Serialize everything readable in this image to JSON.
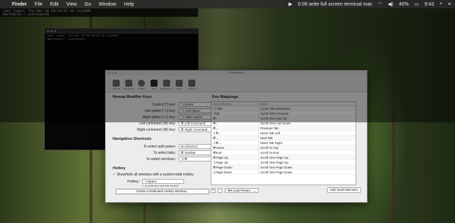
{
  "menubar": {
    "app": "Finder",
    "items": [
      "File",
      "Edit",
      "View",
      "Go",
      "Window",
      "Help"
    ],
    "status_text": "0:06 write full screen terminal mac",
    "battery": "40%",
    "time": "9:43"
  },
  "terminal_top": {
    "line1": "Last login: Thu Dec 28 03:10:07 on ttys000",
    "line2": "MacThGray:~ justinpot$"
  },
  "terminal_window": {
    "line1": "Last login: Thu Dec 28 09:38:13 on ttys001",
    "line2": "MacThGrey:~ justinpot$"
  },
  "prefs": {
    "title": "Preferences",
    "toolbar": [
      "General",
      "Appearance",
      "Profiles",
      "Keys",
      "Arrangements",
      "Pointer",
      "Advanced"
    ],
    "remap_heading": "Remap Modifier Keys",
    "remap_rows": [
      {
        "label": "Control (^) key:",
        "value": "^ Control"
      },
      {
        "label": "Left option (⌥) key:",
        "value": "⌥ Left Option"
      },
      {
        "label": "Right option (⌥) key:",
        "value": "⌥ Right Option"
      },
      {
        "label": "Left command (⌘) key:",
        "value": "⌘ Left Command"
      },
      {
        "label": "Right command (⌘) key:",
        "value": "⌘ Right Command"
      }
    ],
    "nav_heading": "Navigation Shortcuts",
    "nav_rows": [
      {
        "label": "To select split panes:",
        "value": "No Shortcut"
      },
      {
        "label": "To select tabs:",
        "value": "⌘ Number"
      },
      {
        "label": "To switch windows:",
        "value": "⌥⌘"
      }
    ],
    "hotkey_heading": "Hotkey",
    "hotkey_check": "Show/hide all windows with a system-wide hotkey",
    "hotkey_label": "Hotkey:",
    "hotkey_value": "⌥Space",
    "hotkey_warn": "⚠ A profile also uses this shortcut",
    "hotkey_button": "Create a Dedicated Hotkey Window...",
    "km_heading": "Key Mappings",
    "km_col_key": "Key Combination",
    "km_col_action": "Action",
    "km_rows": [
      {
        "k": "^⇧Tab",
        "a": "Cycle Tabs Backward"
      },
      {
        "k": "^Tab",
        "a": "Cycle Tabs Forward"
      },
      {
        "k": "⌘↑",
        "a": "Scroll One Line Up"
      },
      {
        "k": "⌘↓",
        "a": "Scroll One Line Down"
      },
      {
        "k": "⌘←",
        "a": "Previous Tab"
      },
      {
        "k": "⇧⌘←",
        "a": "Move Tab Left"
      },
      {
        "k": "⌘→",
        "a": "Next Tab"
      },
      {
        "k": "⇧⌘→",
        "a": "Move Tab Right"
      },
      {
        "k": "⌘Home",
        "a": "Scroll To Top"
      },
      {
        "k": "⌘End",
        "a": "Scroll To End"
      },
      {
        "k": "⌘Page Up",
        "a": "Scroll One Page Up"
      },
      {
        "k": "⇧Page Up",
        "a": "Scroll One Page Up"
      },
      {
        "k": "⌘Page Down",
        "a": "Scroll One Page Down"
      },
      {
        "k": "⇧Page Down",
        "a": "Scroll One Page Down"
      }
    ],
    "add_btn": "+",
    "remove_btn": "−",
    "preset_btn": "Load Preset...",
    "touchbar_btn": "Add Touch Bar Item"
  }
}
